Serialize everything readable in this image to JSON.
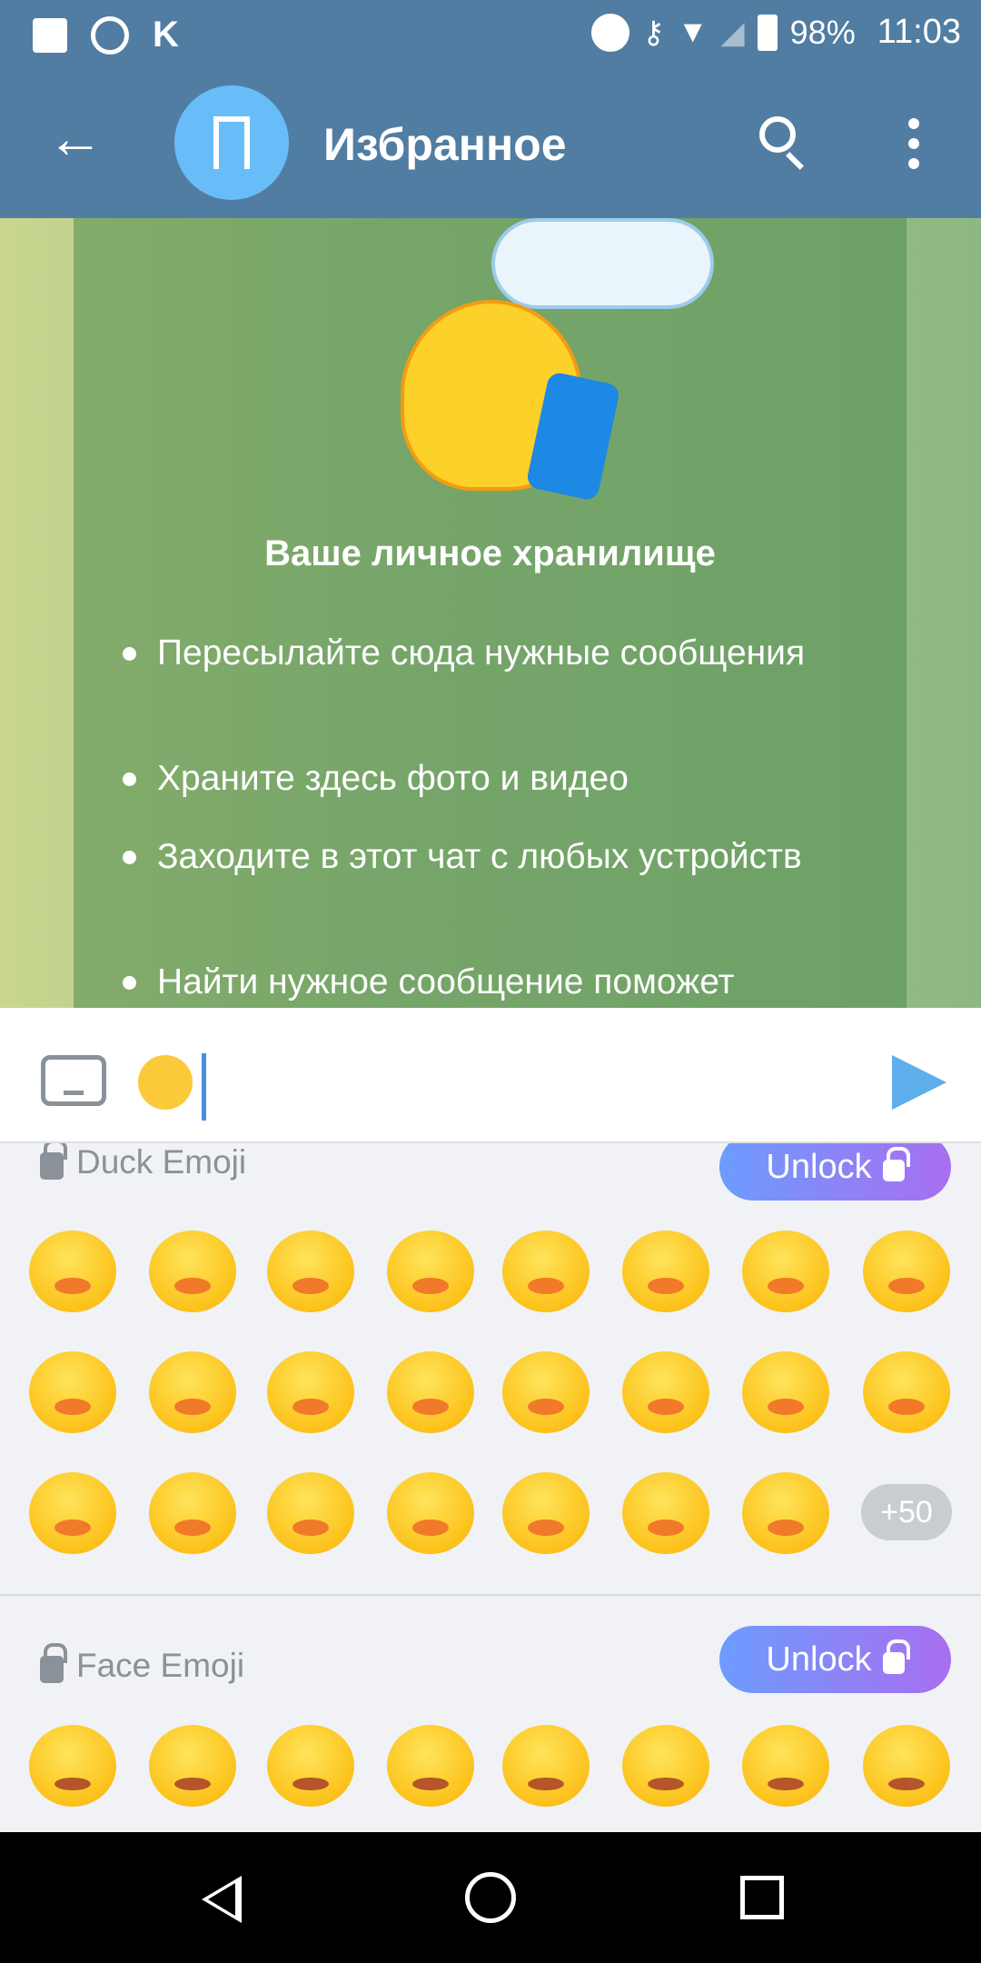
{
  "status_bar": {
    "battery": "98%",
    "time": "11:03",
    "icons": [
      "gallery-icon",
      "clock-icon",
      "k-app-icon",
      "dnd-icon",
      "vpn-key-icon",
      "wifi-icon",
      "signal-icon",
      "battery-icon"
    ]
  },
  "header": {
    "title": "Избранное",
    "avatar_icon": "bookmark-icon"
  },
  "card": {
    "title": "Ваше личное хранилище",
    "bullets": [
      "Пересылайте сюда нужные сообщения",
      "Храните здесь фото и видео",
      "Заходите в этот чат с любых устройств",
      "Найти нужное сообщение поможет"
    ]
  },
  "input": {
    "value_emoji": "salute-smile-emoji"
  },
  "emoji_panel": {
    "sections": [
      {
        "title": "Duck Emoji",
        "unlock_label": "Unlock",
        "more_label": "+50",
        "count_visible": 23
      },
      {
        "title": "Face Emoji",
        "unlock_label": "Unlock",
        "count_visible": 8
      }
    ]
  },
  "colors": {
    "header": "#517da2",
    "accent": "#68bdf9",
    "send": "#5eaeeb",
    "unlock_from": "#6c9cff",
    "unlock_to": "#a96ef0"
  }
}
